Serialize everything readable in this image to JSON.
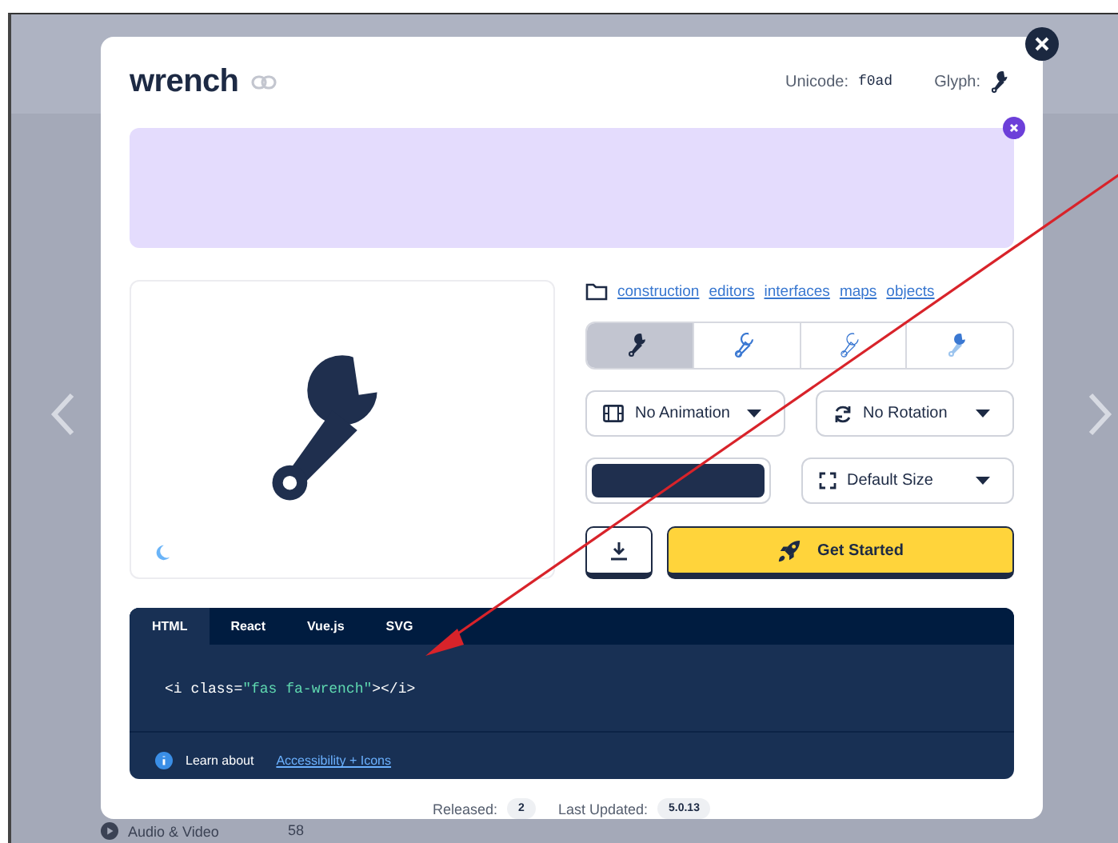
{
  "background": {
    "list_item": {
      "label": "Audio & Video",
      "count": "58"
    }
  },
  "modal": {
    "title": "wrench",
    "unicode_label": "Unicode:",
    "unicode": "f0ad",
    "glyph_label": "Glyph:",
    "tags": [
      "construction",
      "editors",
      "interfaces",
      "maps",
      "objects"
    ],
    "styles": [
      {
        "kind": "solid",
        "selected": true
      },
      {
        "kind": "regular",
        "selected": false
      },
      {
        "kind": "light",
        "selected": false
      },
      {
        "kind": "duotone",
        "selected": false
      }
    ],
    "animation": {
      "label": "No Animation"
    },
    "rotation": {
      "label": "No Rotation"
    },
    "color_picker": {
      "color": "#1f2f4e"
    },
    "size": {
      "label": "Default Size"
    },
    "get_started": "Get Started",
    "code": {
      "tabs": [
        {
          "label": "HTML",
          "selected": true
        },
        {
          "label": "React",
          "selected": false
        },
        {
          "label": "Vue.js",
          "selected": false
        },
        {
          "label": "SVG",
          "selected": false
        }
      ],
      "before": "<i class=",
      "value": "\"fas fa-wrench\"",
      "after": "></i>",
      "learn": "Learn about",
      "link": "Accessibility + Icons"
    },
    "released_label": "Released:",
    "released": "2",
    "updated_label": "Last Updated:",
    "updated": "5.0.13"
  }
}
